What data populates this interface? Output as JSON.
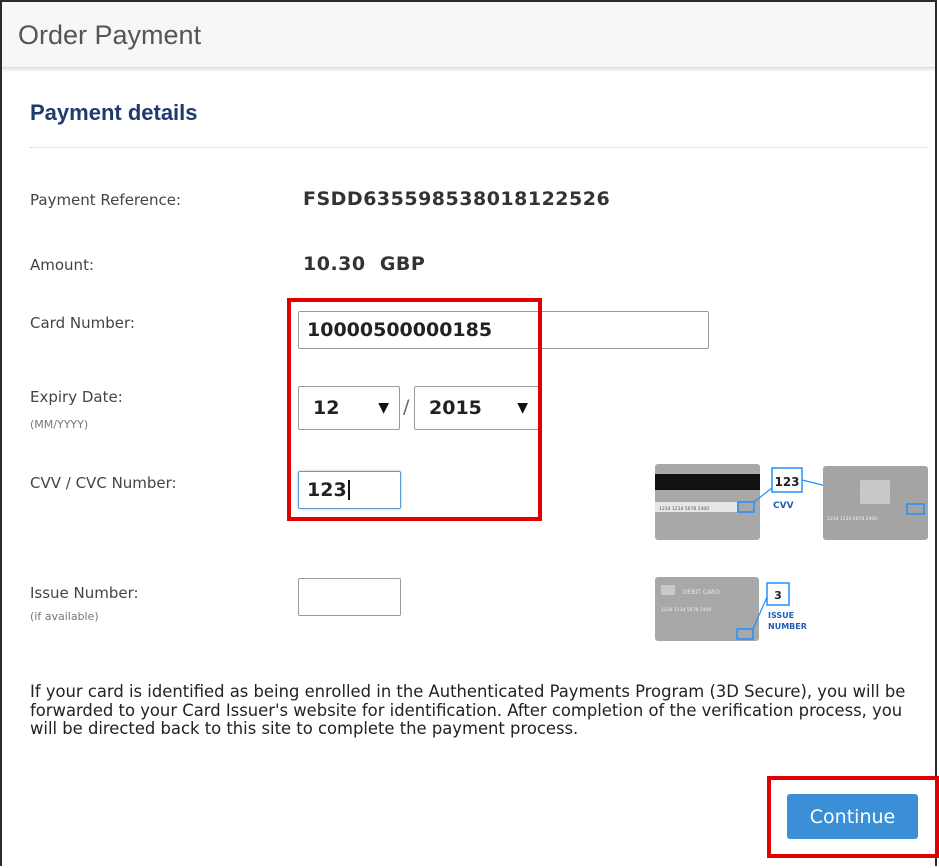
{
  "header": {
    "title": "Order Payment"
  },
  "section": {
    "title": "Payment details"
  },
  "fields": {
    "payment_reference": {
      "label": "Payment Reference:",
      "value": "FSDD635598538018122526"
    },
    "amount": {
      "label": "Amount:",
      "value": "10.30  GBP"
    },
    "card_number": {
      "label": "Card Number:",
      "value": "10000500000185"
    },
    "expiry": {
      "label": "Expiry Date:",
      "hint": "(MM/YYYY)",
      "month": "12",
      "year": "2015",
      "separator": "/"
    },
    "cvv": {
      "label": "CVV / CVC Number:",
      "value": "123"
    },
    "issue_number": {
      "label": "Issue Number:",
      "hint": "(if available)",
      "value": ""
    }
  },
  "illustrations": {
    "cvv_card": {
      "front_digits": "1234 1234 5678 2400",
      "back_digits": "1234 1234 5678 2400",
      "callout_value": "123",
      "callout_label": "CVV"
    },
    "issue_card": {
      "card_label": "DEBIT CARD",
      "digits": "1234 1234 5678 2400",
      "callout_value": "3",
      "callout_label_line1": "ISSUE",
      "callout_label_line2": "NUMBER"
    }
  },
  "info_text": "If your card is identified as being enrolled in the Authenticated Payments Program (3D Secure), you will be forwarded to your Card Issuer's website for identification. After completion of the verification process, you will be directed back to this site to complete the payment process.",
  "actions": {
    "continue_label": "Continue"
  },
  "colors": {
    "accent": "#3b8fd6",
    "heading": "#1f3a6e",
    "highlight": "#e00000"
  }
}
